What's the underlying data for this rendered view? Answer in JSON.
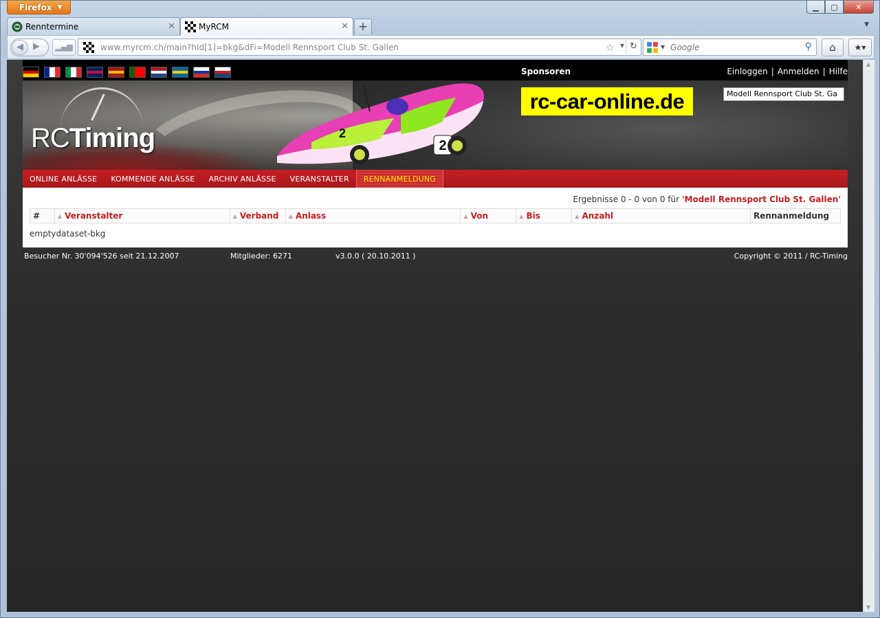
{
  "browser": {
    "menu_button": "Firefox",
    "tabs": [
      {
        "title": "Renntermine"
      },
      {
        "title": "MyRCM"
      }
    ],
    "url": "www.myrcm.ch/main?hId[1]=bkg&dFi=Modell Rennsport Club St. Gallen",
    "search_placeholder": "Google"
  },
  "site": {
    "flags": [
      {
        "name": "de-flag",
        "colors": [
          "#000000",
          "#dd0000",
          "#ffce00"
        ],
        "dir": "h"
      },
      {
        "name": "fr-flag",
        "colors": [
          "#002395",
          "#ffffff",
          "#ed2939"
        ],
        "dir": "v"
      },
      {
        "name": "it-flag",
        "colors": [
          "#009246",
          "#ffffff",
          "#ce2b37"
        ],
        "dir": "v"
      },
      {
        "name": "uk-flag",
        "colors": [
          "#012169",
          "#c8102e",
          "#012169"
        ],
        "dir": "h"
      },
      {
        "name": "es-flag",
        "colors": [
          "#aa151b",
          "#f1bf00",
          "#aa151b"
        ],
        "dir": "h"
      },
      {
        "name": "pt-flag",
        "colors": [
          "#006600",
          "#ff0000",
          "#ff0000"
        ],
        "dir": "v"
      },
      {
        "name": "nl-flag",
        "colors": [
          "#ae1c28",
          "#ffffff",
          "#21468b"
        ],
        "dir": "h"
      },
      {
        "name": "se-flag",
        "colors": [
          "#006aa7",
          "#fecc00",
          "#006aa7"
        ],
        "dir": "h"
      },
      {
        "name": "ru-flag",
        "colors": [
          "#ffffff",
          "#0039a6",
          "#d52b1e"
        ],
        "dir": "h"
      },
      {
        "name": "cz-flag",
        "colors": [
          "#ffffff",
          "#d7141a",
          "#11457e"
        ],
        "dir": "h"
      }
    ],
    "sponsoren_label": "Sponsoren",
    "top_links": {
      "login": "Einloggen",
      "register": "Anmelden",
      "help": "Hilfe",
      "sep": "|"
    },
    "logo": {
      "rc": "RC",
      "timing": "Timing"
    },
    "sponsor": "rc-car-online.de",
    "club_select": "Modell Rennsport Club St. Ga",
    "menu": [
      {
        "label": "ONLINE ANLÄSSE",
        "active": false
      },
      {
        "label": "KOMMENDE ANLÄSSE",
        "active": false
      },
      {
        "label": "ARCHIV ANLÄSSE",
        "active": false
      },
      {
        "label": "VERANSTALTER",
        "active": false
      },
      {
        "label": "RENNANMELDUNG",
        "active": true
      }
    ],
    "results": {
      "prefix": "Ergebnisse 0 - 0 von 0 für",
      "club": "'Modell Rennsport Club St. Gallen'"
    },
    "table": {
      "columns": [
        {
          "label": "#",
          "sortable": false
        },
        {
          "label": "Veranstalter",
          "sortable": true
        },
        {
          "label": "Verband",
          "sortable": true
        },
        {
          "label": "Anlass",
          "sortable": true
        },
        {
          "label": "Von",
          "sortable": true
        },
        {
          "label": "Bis",
          "sortable": true
        },
        {
          "label": "Anzahl",
          "sortable": true
        },
        {
          "label": "Rennanmeldung",
          "sortable": false
        }
      ],
      "empty_text": "emptydataset-bkg"
    },
    "footer": {
      "visitors": "Besucher Nr. 30'094'526 seit 21.12.2007",
      "members": "Mitglieder: 6271",
      "version": "v3.0.0 ( 20.10.2011 )",
      "copyright": "Copyright © 2011 / RC-Timing"
    }
  }
}
